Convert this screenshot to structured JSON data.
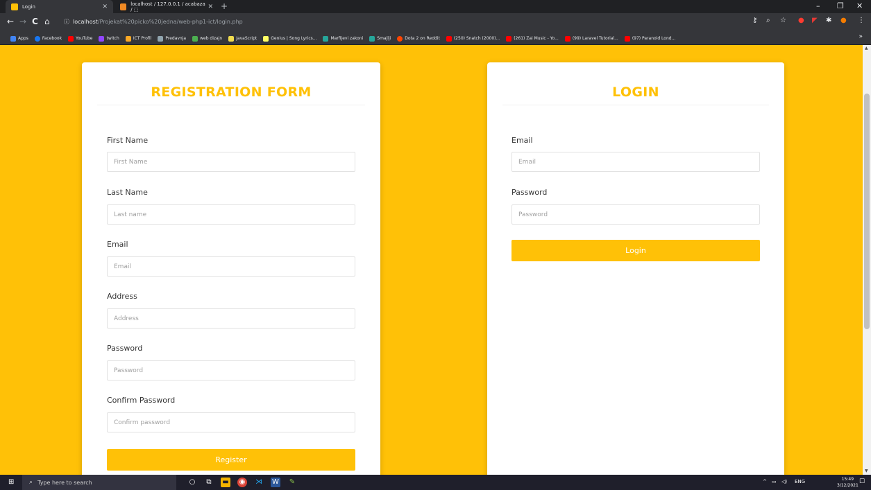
{
  "browser": {
    "tabs": [
      {
        "title": "Login",
        "active": true
      },
      {
        "title": "localhost / 127.0.0.1 / acabaza / ⬚",
        "active": false
      }
    ],
    "tab_close": "✕",
    "new_tab": "+",
    "window_controls": {
      "minimize": "–",
      "maximize": "❐",
      "close": "✕"
    },
    "nav": {
      "back": "←",
      "forward": "→",
      "reload": "C",
      "home": "⌂"
    },
    "url_host": "localhost",
    "url_path": "/Projekat%20picko%20jedna/web-php1-ict/login.php",
    "info_glyph": "ⓘ",
    "bookmarks": [
      {
        "label": "Apps",
        "color": "#4285f4"
      },
      {
        "label": "Facebook",
        "color": "#1877f2"
      },
      {
        "label": "YouTube",
        "color": "#ff0000"
      },
      {
        "label": "twitch",
        "color": "#9146ff"
      },
      {
        "label": "ICT Profil",
        "color": "#f9a825"
      },
      {
        "label": "Predavnja",
        "color": "#90a4ae"
      },
      {
        "label": "web dizajn",
        "color": "#4caf50"
      },
      {
        "label": "JavaScript",
        "color": "#f0db4f"
      },
      {
        "label": "Genius | Song Lyrics...",
        "color": "#ffff64"
      },
      {
        "label": "Marfijevi zakoni",
        "color": "#26a69a"
      },
      {
        "label": "Smajlji",
        "color": "#26a69a"
      },
      {
        "label": "Dota 2 on Reddit",
        "color": "#ff4500"
      },
      {
        "label": "(250) Snatch (2000)...",
        "color": "#ff0000"
      },
      {
        "label": "(261) Zai Music - Yo...",
        "color": "#ff0000"
      },
      {
        "label": "(99) Laravel Tutorial...",
        "color": "#ff0000"
      },
      {
        "label": "(97) Paranoid Lond...",
        "color": "#ff0000"
      }
    ],
    "bookmarks_more": "»"
  },
  "registration": {
    "title": "REGISTRATION FORM",
    "fields": [
      {
        "label": "First Name",
        "placeholder": "First Name",
        "value": ""
      },
      {
        "label": "Last Name",
        "placeholder": "Last name",
        "value": ""
      },
      {
        "label": "Email",
        "placeholder": "Email",
        "value": ""
      },
      {
        "label": "Address",
        "placeholder": "Address",
        "value": ""
      },
      {
        "label": "Password",
        "placeholder": "Password",
        "value": ""
      },
      {
        "label": "Confirm Password",
        "placeholder": "Confirm password",
        "value": ""
      }
    ],
    "submit_label": "Register"
  },
  "login": {
    "title": "LOGIN",
    "fields": [
      {
        "label": "Email",
        "placeholder": "Email",
        "value": ""
      },
      {
        "label": "Password",
        "placeholder": "Password",
        "value": ""
      }
    ],
    "submit_label": "Login"
  },
  "colors": {
    "accent": "#ffc107",
    "page_background": "#ffc107",
    "card": "#ffffff"
  },
  "taskbar": {
    "search_placeholder": "Type here to search",
    "tray_language": "ENG",
    "clock_time": "15:49",
    "clock_date": "3/12/2021"
  }
}
